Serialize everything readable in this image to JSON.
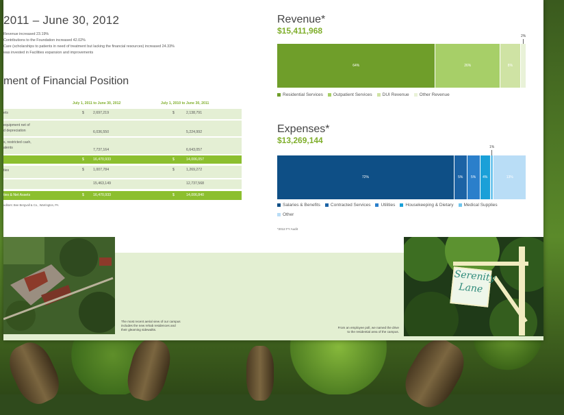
{
  "left": {
    "heading": "2011 – June 30, 2012",
    "bullets": [
      "Revenue increased 23.19%",
      "Contributions to the Foundation increased 42.02%",
      "Care (scholarships to patients in need of treatment but lacking the financial resources) increased 24.33%",
      "was invested in Facilities expansion and improvements"
    ],
    "statement_title": "ment of Financial Position",
    "col1": "July 1, 2011 to June 30, 2012",
    "col2": "July 1, 2010 to June 30, 2011",
    "rows": [
      {
        "label": "ets",
        "c1_cur": "$",
        "c1": "2,697,219",
        "c2_cur": "$",
        "c2": "2,138,791"
      },
      {
        "label": "equipment net of\nd depreciation",
        "c1_cur": "",
        "c1": "6,036,550",
        "c2_cur": "",
        "c2": "5,224,992"
      },
      {
        "label": "s, restricted cash,\nalents",
        "c1_cur": "",
        "c1": "7,737,164",
        "c2_cur": "",
        "c2": "6,643,057"
      },
      {
        "label": "",
        "c1_cur": "$",
        "c1": "16,470,933",
        "c2_cur": "$",
        "c2": "14,006,057"
      },
      {
        "label": "ties",
        "c1_cur": "$",
        "c1": "1,007,784",
        "c2_cur": "$",
        "c2": "1,269,272"
      },
      {
        "label": "",
        "c1_cur": "",
        "c1": "15,463,149",
        "c2_cur": "",
        "c2": "12,737,568"
      },
      {
        "label": "ties & Net Assets",
        "c1_cur": "$",
        "c1": "16,470,933",
        "c2_cur": "$",
        "c2": "14,006,840"
      }
    ],
    "auditor_note": "uditors: Bee Bergvall & Co., Warrington, PA"
  },
  "revenue": {
    "title": "Revenue*",
    "amount": "$15,411,968",
    "top_label": "2%",
    "segments": [
      {
        "label": "64%",
        "pct": 64,
        "color": "#6f9e2a"
      },
      {
        "label": "26%",
        "pct": 26,
        "color": "#a7cf68"
      },
      {
        "label": "8%",
        "pct": 8,
        "color": "#cfe3a4"
      },
      {
        "label": "",
        "pct": 2,
        "color": "#e9f2d8"
      }
    ],
    "legend": [
      "Residential Services",
      "Outpatient Services",
      "DUI Revenue",
      "Other Revenue"
    ]
  },
  "expenses": {
    "title": "Expenses*",
    "amount": "$13,269,144",
    "top_label": "1%",
    "segments": [
      {
        "label": "72%",
        "pct": 72,
        "color": "#0e4f86"
      },
      {
        "label": "5%",
        "pct": 5,
        "color": "#1c63a5"
      },
      {
        "label": "5%",
        "pct": 5,
        "color": "#2b7fcb"
      },
      {
        "label": "4%",
        "pct": 4,
        "color": "#1aa0d8"
      },
      {
        "label": "",
        "pct": 1,
        "color": "#6fc6ee"
      },
      {
        "label": "13%",
        "pct": 13,
        "color": "#b9ddf6"
      }
    ],
    "legend": [
      "Salaries & Benefits",
      "Contracted Services",
      "Utilities",
      "Housekeeping & Dietary",
      "Medical Supplies",
      "Other"
    ],
    "footnote": "*2012 FY Audit"
  },
  "photos": {
    "caption_left": "The most recent aerial view of our campus\nincludes the new rehab residences and\ntheir gleaming sidewalks.",
    "caption_right": "From an employee poll, we named the drive\nto the residential area of the campus.",
    "sign_line1": "Serenity",
    "sign_line2": "Lane"
  }
}
